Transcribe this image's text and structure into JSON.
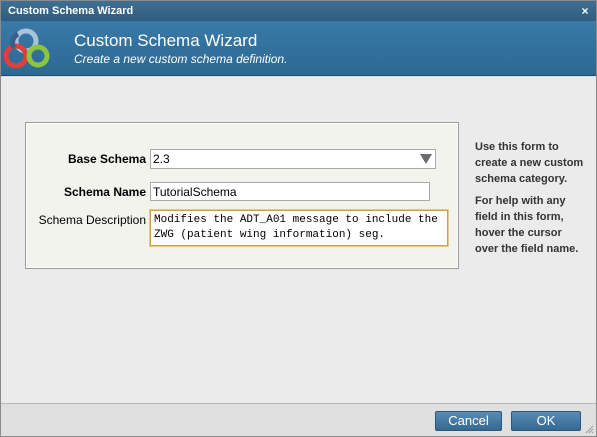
{
  "window": {
    "title": "Custom Schema Wizard",
    "close_glyph": "×"
  },
  "header": {
    "title": "Custom Schema Wizard",
    "subtitle": "Create a new custom schema definition.",
    "logo_colors": [
      "#3a5f8a",
      "#a8c4dc",
      "#d9423a",
      "#8cc63f"
    ]
  },
  "form": {
    "base_schema_label": "Base Schema",
    "base_schema_value": "2.3",
    "schema_name_label": "Schema Name",
    "schema_name_value": "TutorialSchema",
    "schema_description_label": "Schema Description",
    "schema_description_value": "Modifies the ADT_A01 message to include the ZWG (patient wing information) seg."
  },
  "help": {
    "para1": "Use this form to create a new custom schema category.",
    "para2": "For help with any field in this form, hover the cursor over the field name."
  },
  "footer": {
    "cancel_label": "Cancel",
    "ok_label": "OK"
  },
  "colors": {
    "header_blue": "#2c6892",
    "button_blue": "#356992",
    "focus_border": "#c8a04a"
  }
}
